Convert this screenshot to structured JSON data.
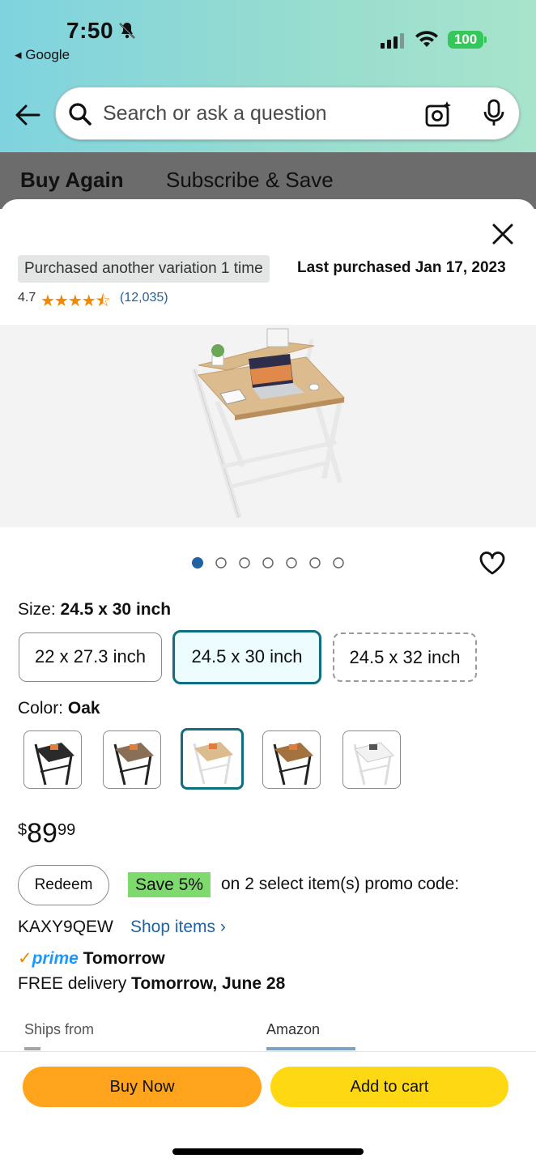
{
  "status": {
    "time": "7:50",
    "back_app": "◂ Google",
    "battery": "100"
  },
  "search": {
    "placeholder": "Search or ask a question"
  },
  "tabs": [
    "Buy Again",
    "Subscribe & Save"
  ],
  "product": {
    "purchased_badge": "Purchased another variation 1 time",
    "last_purchased": "Last purchased Jan 17, 2023",
    "rating": "4.7",
    "stars": "★★★★⯪",
    "reviews": "(12,035)",
    "image_count": 7,
    "image_index": 1
  },
  "size": {
    "label": "Size: ",
    "selected": "24.5 x 30 inch",
    "options": [
      "22 x 27.3 inch",
      "24.5 x 30 inch",
      "24.5 x 32 inch"
    ]
  },
  "color": {
    "label": "Color: ",
    "selected": "Oak",
    "swatches": [
      "black-black",
      "black-rustic",
      "white-oak",
      "black-walnut",
      "white-white"
    ]
  },
  "price": {
    "currency": "$",
    "whole": "89",
    "fraction": "99"
  },
  "promo": {
    "redeem": "Redeem",
    "save": "Save 5%",
    "text": "on 2 select item(s) promo code:",
    "code": "KAXY9QEW",
    "shop": "Shop items ›"
  },
  "delivery": {
    "check": "✓",
    "prime": "prime",
    "prime_day": "Tomorrow",
    "free": "FREE delivery ",
    "date": "Tomorrow, June 28"
  },
  "ships": {
    "label": "Ships from",
    "value": "Amazon"
  },
  "actions": {
    "buy_now": "Buy Now",
    "add_to_cart": "Add to cart"
  },
  "colors": {
    "buy_now": "#ffa41c",
    "add_to_cart": "#ffd814",
    "selected_border": "#0f6f80",
    "link": "#2162a1"
  }
}
